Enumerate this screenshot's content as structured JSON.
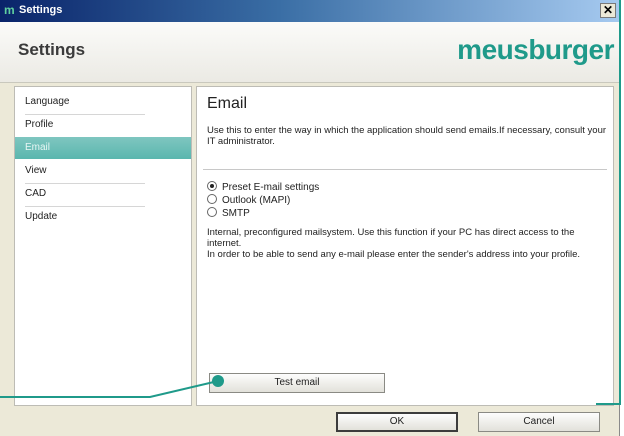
{
  "window": {
    "title": "Settings",
    "close_glyph": "✕"
  },
  "header": {
    "title": "Settings",
    "logo": "meusburger"
  },
  "nav": {
    "items": [
      {
        "label": "Language"
      },
      {
        "label": "Profile"
      },
      {
        "label": "Email",
        "selected": true
      },
      {
        "label": "View"
      },
      {
        "label": "CAD"
      },
      {
        "label": "Update"
      }
    ]
  },
  "content": {
    "title": "Email",
    "description": "Use this to enter the way in which the application should send emails.If necessary, consult your IT administrator.",
    "options": [
      {
        "label": "Preset E-mail settings",
        "checked": true
      },
      {
        "label": "Outlook (MAPI)",
        "checked": false
      },
      {
        "label": "SMTP",
        "checked": false
      }
    ],
    "info_line1": "Internal, preconfigured mailsystem. Use this function if your PC has direct access to the internet.",
    "info_line2": "In order to be able to send any e-mail please enter the sender's address into your profile.",
    "test_button": "Test email"
  },
  "footer": {
    "ok": "OK",
    "cancel": "Cancel"
  },
  "colors": {
    "accent": "#1f9a8a",
    "selection": "#5ab6ae",
    "titlebar": "#0a246a"
  }
}
